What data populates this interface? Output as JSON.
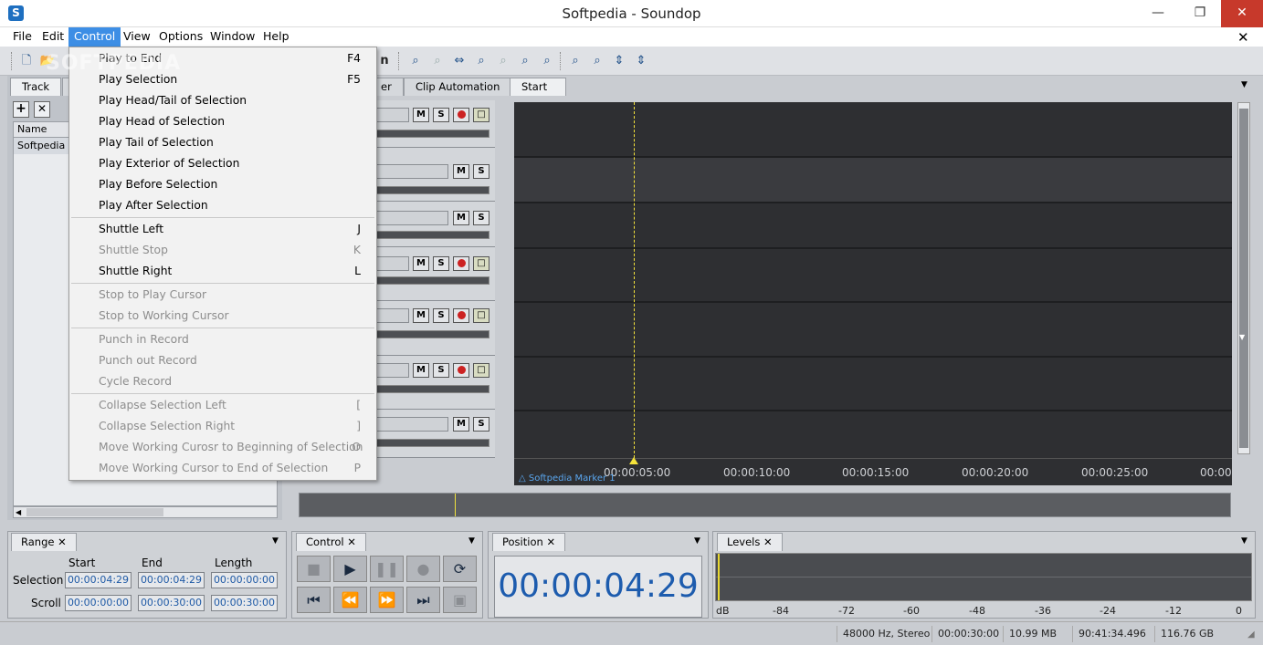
{
  "window": {
    "title": "Softpedia - Soundop",
    "app_icon": "S"
  },
  "menubar": [
    "File",
    "Edit",
    "Control",
    "View",
    "Options",
    "Window",
    "Help"
  ],
  "left_panel": {
    "tab": "Track",
    "header": "Name",
    "track": "Softpedia I"
  },
  "right_tabs": [
    "er",
    "Clip Automation",
    "Start"
  ],
  "strip_buttons": {
    "mute": "M",
    "solo": "S"
  },
  "timeline": {
    "ticks": [
      "00:00:05:00",
      "00:00:10:00",
      "00:00:15:00",
      "00:00:20:00",
      "00:00:25:00",
      "00:00:"
    ],
    "marker": "Softpedia Marker 1"
  },
  "control_menu": {
    "groups": [
      [
        {
          "label": "Play to End",
          "key": "F4",
          "enabled": true
        },
        {
          "label": "Play Selection",
          "key": "F5",
          "enabled": true
        },
        {
          "label": "Play Head/Tail of Selection",
          "key": "",
          "enabled": true
        },
        {
          "label": "Play Head of Selection",
          "key": "",
          "enabled": true
        },
        {
          "label": "Play Tail of Selection",
          "key": "",
          "enabled": true
        },
        {
          "label": "Play Exterior of Selection",
          "key": "",
          "enabled": true
        },
        {
          "label": "Play Before Selection",
          "key": "",
          "enabled": true
        },
        {
          "label": "Play After Selection",
          "key": "",
          "enabled": true
        }
      ],
      [
        {
          "label": "Shuttle Left",
          "key": "J",
          "enabled": true
        },
        {
          "label": "Shuttle Stop",
          "key": "K",
          "enabled": false
        },
        {
          "label": "Shuttle Right",
          "key": "L",
          "enabled": true
        }
      ],
      [
        {
          "label": "Stop to Play Cursor",
          "key": "",
          "enabled": false
        },
        {
          "label": "Stop to Working Cursor",
          "key": "",
          "enabled": false
        }
      ],
      [
        {
          "label": "Punch in Record",
          "key": "",
          "enabled": false
        },
        {
          "label": "Punch out Record",
          "key": "",
          "enabled": false
        },
        {
          "label": "Cycle Record",
          "key": "",
          "enabled": false
        }
      ],
      [
        {
          "label": "Collapse Selection Left",
          "key": "[",
          "enabled": false
        },
        {
          "label": "Collapse Selection Right",
          "key": "]",
          "enabled": false
        },
        {
          "label": "Move Working Curosr to Beginning of Selection",
          "key": "O",
          "enabled": false
        },
        {
          "label": "Move Working Cursor to End of Selection",
          "key": "P",
          "enabled": false
        }
      ]
    ]
  },
  "range_panel": {
    "tab": "Range",
    "cols": [
      "Start",
      "End",
      "Length"
    ],
    "selection_label": "Selection",
    "scroll_label": "Scroll",
    "selection": [
      "00:00:04:29",
      "00:00:04:29",
      "00:00:00:00"
    ],
    "scroll": [
      "00:00:00:00",
      "00:00:30:00",
      "00:00:30:00"
    ]
  },
  "control_panel": {
    "tab": "Control"
  },
  "position_panel": {
    "tab": "Position",
    "value": "00:00:04:29"
  },
  "levels_panel": {
    "tab": "Levels",
    "scale": [
      "dB",
      "-84",
      "-72",
      "-60",
      "-48",
      "-36",
      "-24",
      "-12",
      "0"
    ]
  },
  "statusbar": [
    "48000 Hz, Stereo",
    "00:00:30:00",
    "10.99 MB",
    "90:41:34.496",
    "116.76 GB"
  ],
  "watermark": "SOFTPEDIA"
}
